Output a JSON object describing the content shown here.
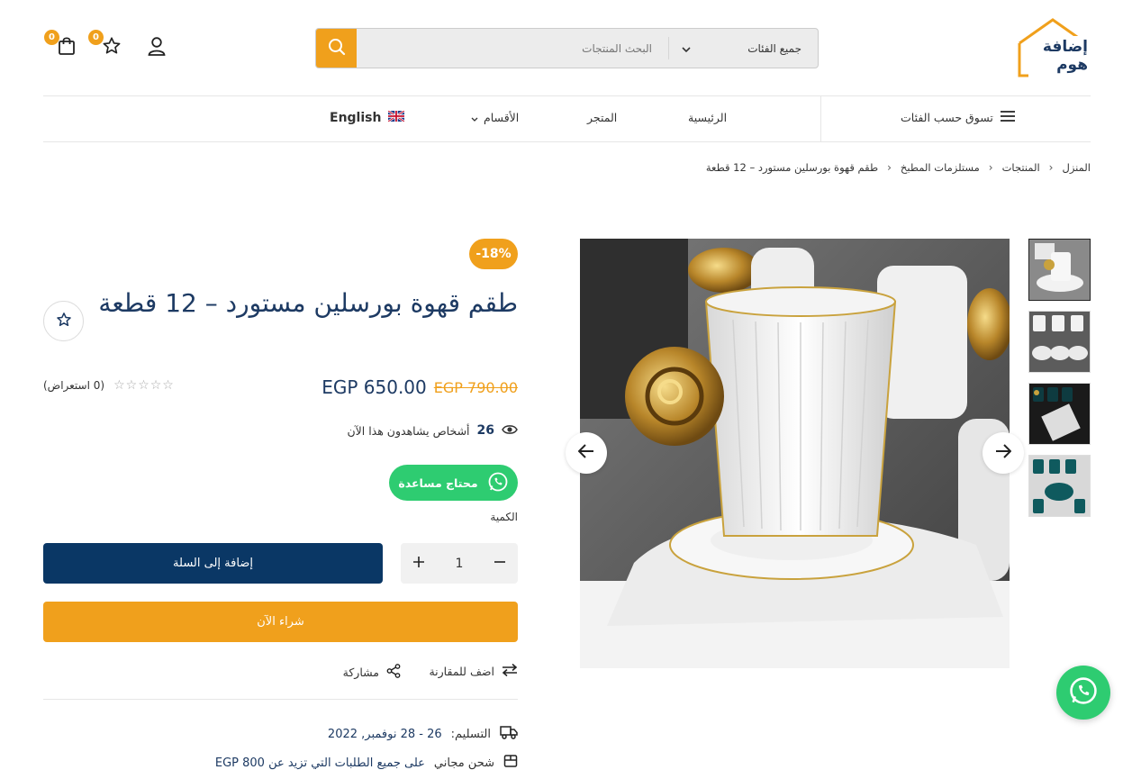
{
  "header": {
    "logo_text": "إضافة هوم",
    "search_category": "جميع الفئات",
    "search_placeholder": "البحث المنتجات",
    "wishlist_count": "0",
    "cart_count": "0"
  },
  "nav": {
    "shop_by_category": "تسوق حسب الفئات",
    "home": "الرئيسية",
    "store": "المتجر",
    "sections": "الأقسام",
    "language": "English"
  },
  "breadcrumb": [
    "المنزل",
    "المنتجات",
    "مستلزمات المطبخ",
    "طقم قهوة بورسلين مستورد – 12 قطعة"
  ],
  "product": {
    "discount": "-18%",
    "title": "طقم قهوة بورسلين مستورد – 12 قطعة",
    "price_new": "EGP 650.00",
    "price_old": "EGP 790.00",
    "rating_text": "(0 استعراض)",
    "rating_value": 0,
    "viewers_count": "26",
    "viewers_text": "أشخاص يشاهدون هذا الآن",
    "help_label": "محتاج مساعدة",
    "qty_label": "الكمية",
    "qty_value": "1",
    "add_to_cart": "إضافة إلى السلة",
    "buy_now": "شراء الآن",
    "compare": "اضف للمقارنة",
    "share": "مشاركة",
    "delivery_label": "التسليم:",
    "delivery_value": "26 - 28 نوفمبر, 2022",
    "shipping_label": "شحن مجاني",
    "shipping_value": "على جميع الطلبات التي تزيد عن EGP 800"
  },
  "colors": {
    "accent": "#f0a01c",
    "navy": "#0a3765",
    "whatsapp": "#2ecc71"
  }
}
